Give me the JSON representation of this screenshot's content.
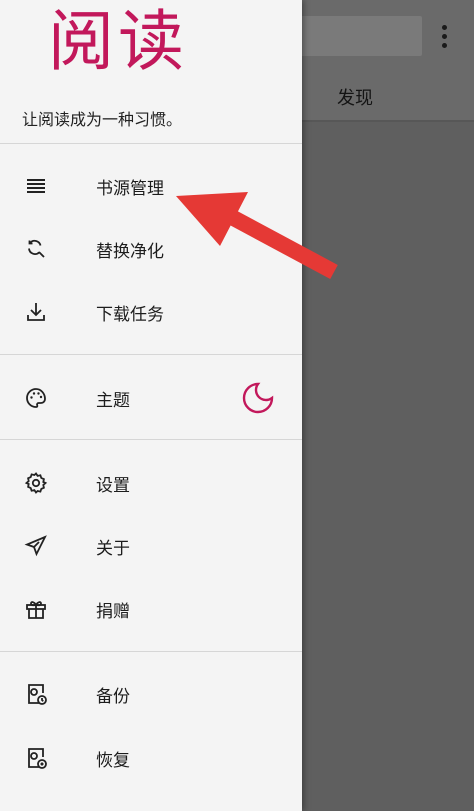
{
  "app": {
    "logo_text": "阅读",
    "tagline": "让阅读成为一种习惯。"
  },
  "background": {
    "tab_label": "发现"
  },
  "drawer": {
    "items": [
      {
        "label": "书源管理",
        "icon": "list-icon"
      },
      {
        "label": "替换净化",
        "icon": "find-replace-icon"
      },
      {
        "label": "下载任务",
        "icon": "download-icon"
      },
      {
        "label": "主题",
        "icon": "palette-icon"
      },
      {
        "label": "设置",
        "icon": "gear-icon"
      },
      {
        "label": "关于",
        "icon": "send-icon"
      },
      {
        "label": "捐赠",
        "icon": "gift-icon"
      },
      {
        "label": "备份",
        "icon": "backup-icon"
      },
      {
        "label": "恢复",
        "icon": "restore-icon"
      }
    ]
  },
  "colors": {
    "accent": "#c2185b",
    "annotation_arrow": "#e53935"
  }
}
